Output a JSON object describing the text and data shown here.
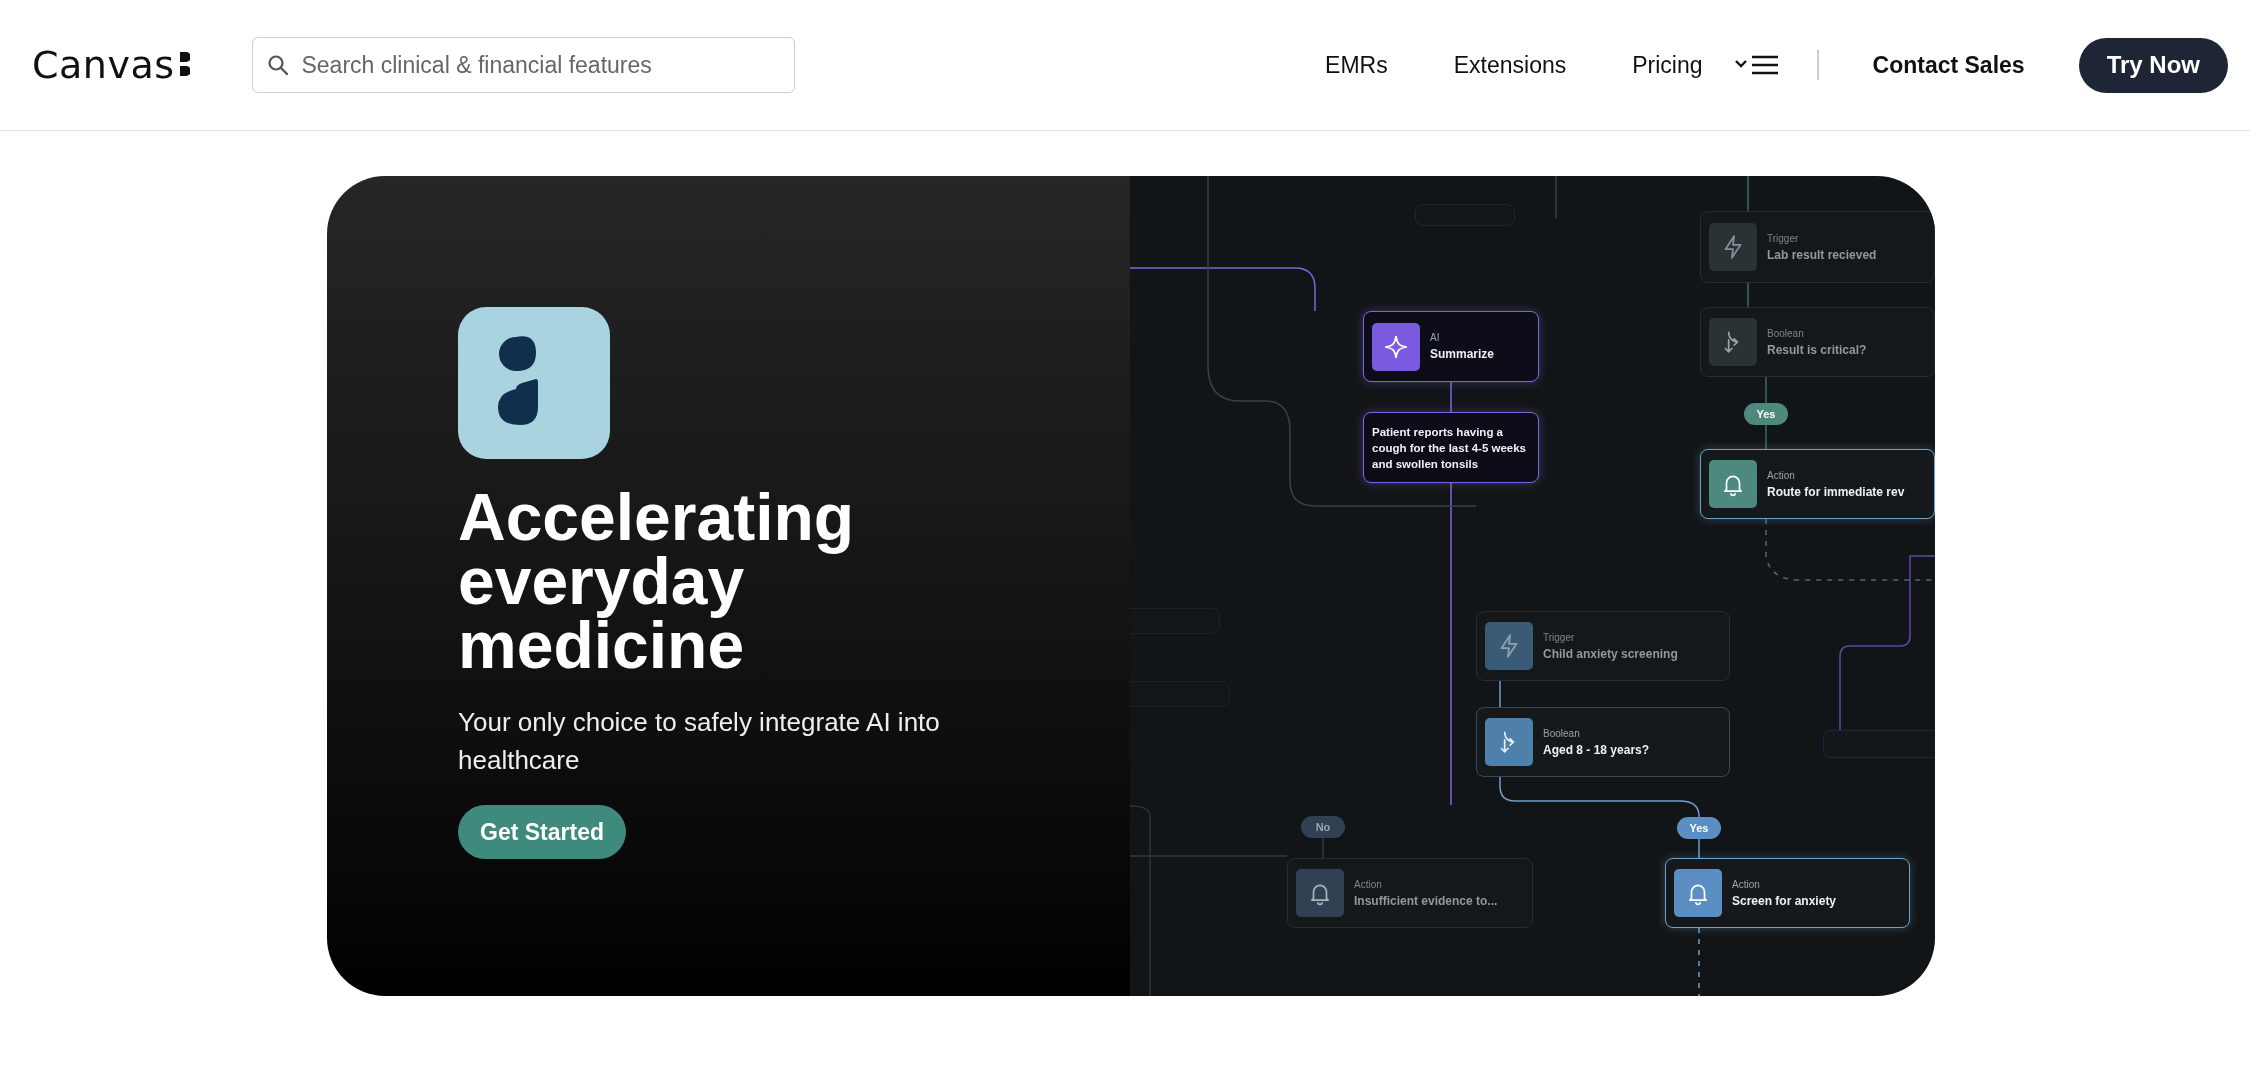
{
  "header": {
    "logo": "Canvas",
    "search": {
      "placeholder": "Search clinical & financial features"
    },
    "nav": [
      {
        "label": "EMRs"
      },
      {
        "label": "Extensions"
      },
      {
        "label": "Pricing"
      }
    ],
    "contact": "Contact Sales",
    "cta": "Try Now"
  },
  "hero": {
    "title": "Accelerating everyday medicine",
    "subtitle": "Your only choice to safely integrate AI into healthcare",
    "button": "Get Started"
  },
  "workflow": {
    "nodes": [
      {
        "kind": "trigger",
        "type": "Trigger",
        "title": "Lab result recieved",
        "faded": true,
        "color": "#2a3236"
      },
      {
        "kind": "ai",
        "type": "AI",
        "title": "Summarize",
        "faded": false,
        "color": "#7b5ce0"
      },
      {
        "kind": "note",
        "title": "Patient reports having a cough for the last 4-5 weeks and swollen tonsils"
      },
      {
        "kind": "boolean",
        "type": "Boolean",
        "title": "Result is critical?",
        "faded": true,
        "color": "#2a3236"
      },
      {
        "kind": "pill",
        "title": "Yes",
        "faded": false,
        "color": "#4d8a7d"
      },
      {
        "kind": "action",
        "type": "Action",
        "title": "Route for immediate rev",
        "faded": false,
        "color": "#4d8a7d"
      },
      {
        "kind": "trigger",
        "type": "Trigger",
        "title": "Child anxiety screening",
        "faded": true,
        "color": "#3b5a75"
      },
      {
        "kind": "boolean",
        "type": "Boolean",
        "title": "Aged 8 - 18 years?",
        "faded": false,
        "color": "#4f7fab"
      },
      {
        "kind": "pill",
        "title": "No",
        "faded": true,
        "color": "#2f4152"
      },
      {
        "kind": "pill",
        "title": "Yes",
        "faded": false,
        "color": "#5b8fc4"
      },
      {
        "kind": "action",
        "type": "Action",
        "title": "Insufficient evidence to...",
        "faded": true,
        "color": "#2f4152"
      },
      {
        "kind": "action",
        "type": "Action",
        "title": "Screen for anxiety",
        "faded": false,
        "color": "#5b8fc4"
      }
    ]
  }
}
